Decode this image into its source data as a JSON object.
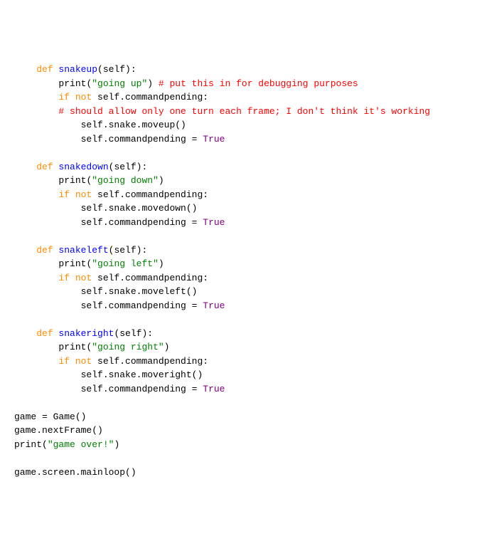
{
  "code": {
    "indent1": "    ",
    "indent2": "        ",
    "indent3": "            ",
    "kw_def": "def",
    "kw_if_not": "if not",
    "kw_print": "print",
    "self_param": "(self):",
    "paren_open": "(",
    "paren_close": ")",
    "self_commandpending": " self.commandpending:",
    "self_commandpending_eq": "self.commandpending = ",
    "true": "True",
    "empty": "",
    "snakeup_name": " snakeup",
    "snakeup_str": "\"going up\"",
    "snakeup_cmt1": " # put this in for debugging purposes",
    "snakeup_cmt2": "# should allow only one turn each frame; I don't think it's working",
    "snakeup_move": "self.snake.moveup()",
    "snakedown_name": " snakedown",
    "snakedown_str": "\"going down\"",
    "snakedown_move": "self.snake.movedown()",
    "snakeleft_name": " snakeleft",
    "snakeleft_str": "\"going left\"",
    "snakeleft_move": "self.snake.moveleft()",
    "snakeright_name": " snakeright",
    "snakeright_str": "\"going right\"",
    "snakeright_move": "self.snake.moveright()",
    "game_assign": "game = Game()",
    "game_nextframe": "game.nextFrame()",
    "gameover_str": "\"game over!\"",
    "game_mainloop": "game.screen.mainloop()"
  }
}
